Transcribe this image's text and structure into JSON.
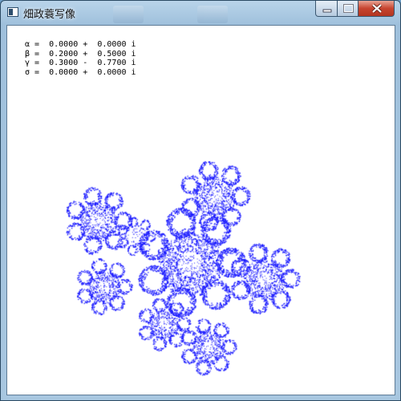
{
  "window": {
    "title": "畑政蓑写像",
    "icon": "app-icon",
    "controls": {
      "minimize_icon": "minimize-icon",
      "maximize_icon": "maximize-icon",
      "close_icon": "close-icon"
    }
  },
  "parameters": [
    {
      "symbol": "α",
      "real": "0.0000",
      "sign": "+",
      "imag": "0.0000",
      "unit": "i"
    },
    {
      "symbol": "β",
      "real": "0.2000",
      "sign": "+",
      "imag": "0.5000",
      "unit": "i"
    },
    {
      "symbol": "γ",
      "real": "0.3000",
      "sign": "-",
      "imag": "0.7700",
      "unit": "i"
    },
    {
      "symbol": "σ",
      "real": "0.0000",
      "sign": "+",
      "imag": "0.0000",
      "unit": "i"
    }
  ],
  "colors": {
    "fractal": "#1a1aff",
    "background": "#ffffff"
  }
}
